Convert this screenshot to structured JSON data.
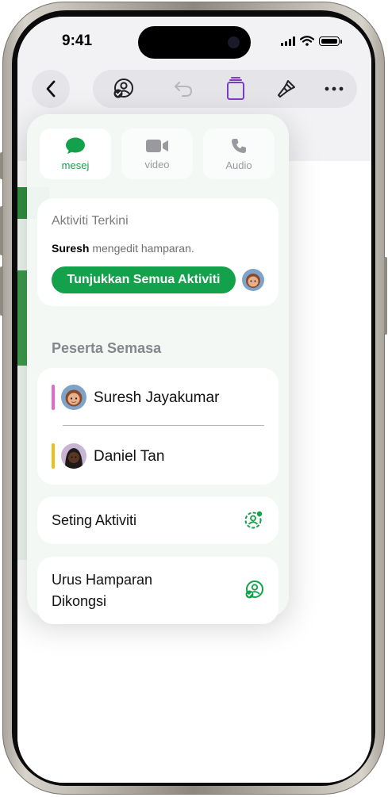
{
  "status_bar": {
    "time": "9:41"
  },
  "toolbar": {
    "back_icon": "chevron-left-icon",
    "collaborate_icon": "person-checkmark-icon",
    "undo_icon": "undo-icon",
    "format_icon": "paintbrush-icon",
    "more_icon": "ellipsis-icon",
    "accent": "#7d3cc8"
  },
  "collab": {
    "communication": [
      {
        "label": "mesej",
        "icon": "message-bubble-icon",
        "active": true
      },
      {
        "label": "video",
        "icon": "video-camera-icon",
        "active": false
      },
      {
        "label": "Audio",
        "icon": "phone-icon",
        "active": false
      }
    ],
    "recent_activity": {
      "title": "Aktiviti Terkini",
      "user": "Suresh",
      "action": "mengedit hamparan.",
      "button": "Tunjukkan Semua Aktiviti"
    },
    "participants_title": "Peserta Semasa",
    "participants": [
      {
        "name": "Suresh Jayakumar",
        "color": "#e06ad0"
      },
      {
        "name": "Daniel Tan",
        "color": "#e6c21a"
      }
    ],
    "activity_settings": {
      "label": "Seting Aktiviti",
      "icon": "gear-person-icon"
    },
    "manage_shared": {
      "line1": "Urus Hamparan",
      "line2": "Dikongsi",
      "icon": "person-checkmark-icon"
    },
    "accent": "#13a24b"
  }
}
